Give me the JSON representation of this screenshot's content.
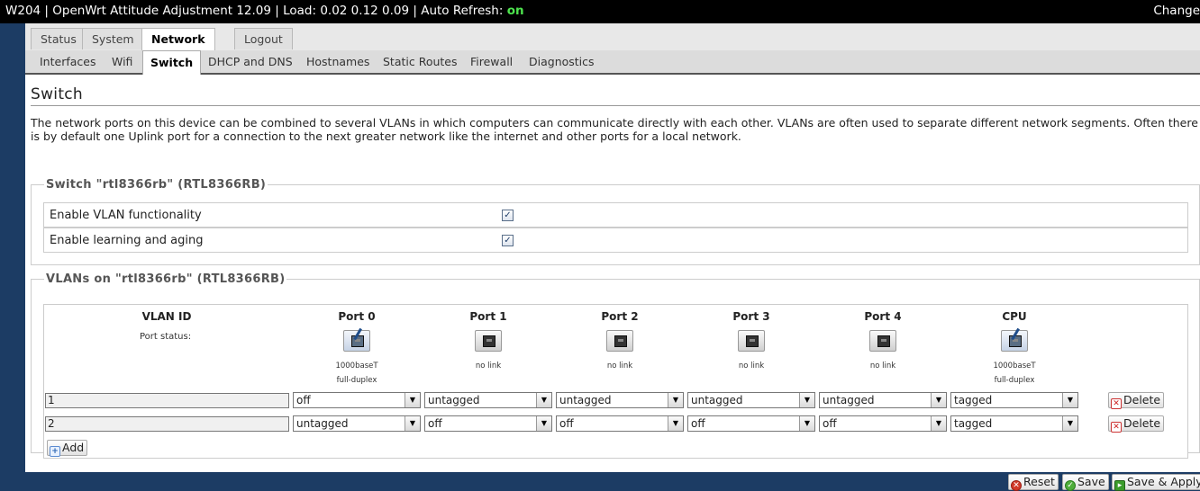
{
  "header": {
    "title_prefix": "W204 | OpenWrt Attitude Adjustment 12.09 | Load: 0.02 0.12 0.09 | Auto Refresh: ",
    "auto_refresh": "on",
    "changes": "Change"
  },
  "top_tabs": [
    "Status",
    "System",
    "Network",
    "Logout"
  ],
  "sub_tabs": [
    "Interfaces",
    "Wifi",
    "Switch",
    "DHCP and DNS",
    "Hostnames",
    "Static Routes",
    "Firewall",
    "Diagnostics"
  ],
  "page": {
    "title": "Switch",
    "description": "The network ports on this device can be combined to several VLANs in which computers can communicate directly with each other. VLANs are often used to separate different network segments. Often there is by default one Uplink port for a connection to the next greater network like the internet and other ports for a local network."
  },
  "switch_section": {
    "legend": "Switch \"rtl8366rb\" (RTL8366RB)",
    "options": [
      {
        "label": "Enable VLAN functionality",
        "checked": true
      },
      {
        "label": "Enable learning and aging",
        "checked": true
      }
    ]
  },
  "vlan_section": {
    "legend": "VLANs on \"rtl8366rb\" (RTL8366RB)",
    "headers": [
      "VLAN ID",
      "Port 0",
      "Port 1",
      "Port 2",
      "Port 3",
      "Port 4",
      "CPU"
    ],
    "port_status_label": "Port status:",
    "ports": [
      {
        "line1": "1000baseT",
        "line2": "full-duplex",
        "link": true
      },
      {
        "line1": "no link",
        "line2": "",
        "link": false
      },
      {
        "line1": "no link",
        "line2": "",
        "link": false
      },
      {
        "line1": "no link",
        "line2": "",
        "link": false
      },
      {
        "line1": "no link",
        "line2": "",
        "link": false
      },
      {
        "line1": "1000baseT",
        "line2": "full-duplex",
        "link": true
      }
    ],
    "rows": [
      {
        "vlan_id": "1",
        "ports": [
          "off",
          "untagged",
          "untagged",
          "untagged",
          "untagged",
          "tagged"
        ],
        "delete_label": "Delete"
      },
      {
        "vlan_id": "2",
        "ports": [
          "untagged",
          "off",
          "off",
          "off",
          "off",
          "tagged"
        ],
        "delete_label": "Delete"
      }
    ],
    "add_label": "Add"
  },
  "actions": {
    "reset": "Reset",
    "save": "Save",
    "save_apply": "Save & Apply"
  }
}
